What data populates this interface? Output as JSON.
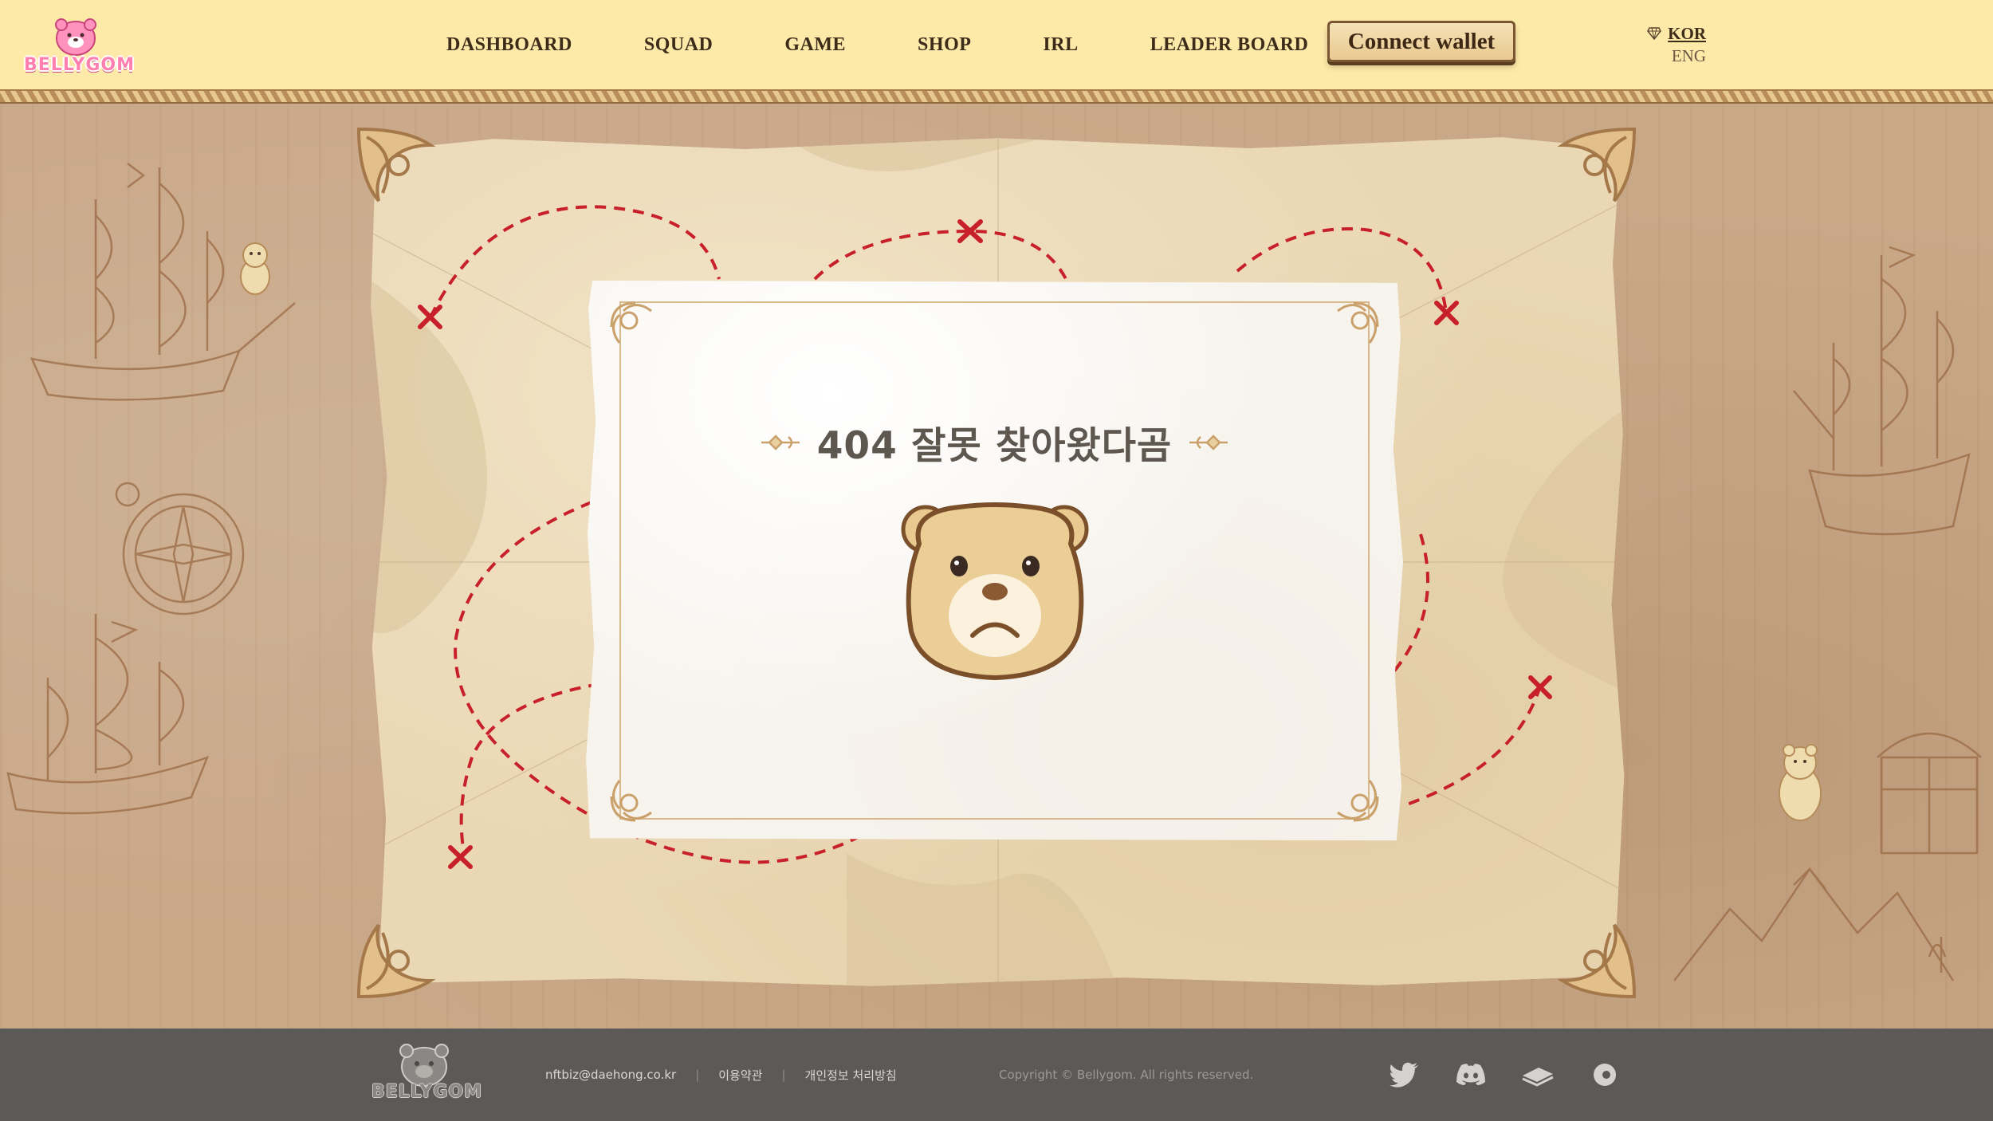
{
  "header": {
    "logo_text": "BELLYGOM",
    "nav": [
      "DASHBOARD",
      "SQUAD",
      "GAME",
      "SHOP",
      "IRL",
      "LEADER BOARD"
    ],
    "connect_wallet": "Connect wallet",
    "lang": {
      "kor": "KOR",
      "eng": "ENG",
      "selected": "KOR"
    }
  },
  "error_card": {
    "title": "404 잘못 찾아왔다곰",
    "mascot": "sad-bear-face"
  },
  "footer": {
    "logo_text": "BELLYGOM",
    "email": "nftbiz@daehong.co.kr",
    "terms": "이용약관",
    "privacy": "개인정보 처리방침",
    "copyright": "Copyright © Bellygom. All rights reserved.",
    "socials": [
      "twitter-icon",
      "discord-icon",
      "gitbook-icon",
      "opensea-icon"
    ]
  },
  "colors": {
    "header_bg": "#fde9a8",
    "footer_bg": "#5b5a58",
    "route_red": "#c8202a",
    "map_paper": "#ead7b3"
  }
}
